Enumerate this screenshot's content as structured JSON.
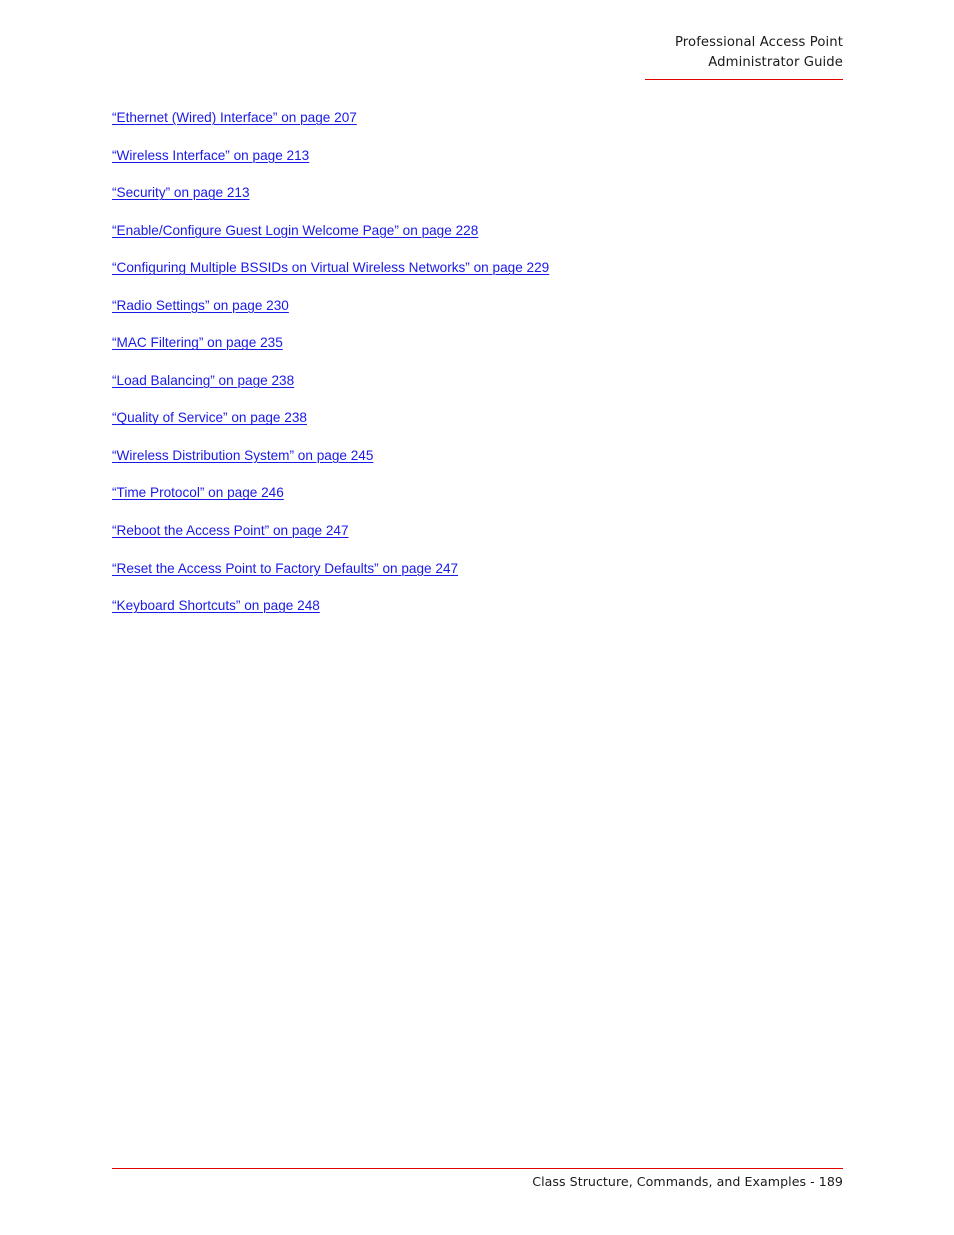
{
  "header": {
    "title_line1": "Professional Access Point",
    "title_line2": "Administrator Guide",
    "rule_color": "#e00000"
  },
  "body": {
    "link_color": "#1a1ae6",
    "links": [
      {
        "text": "“Ethernet (Wired) Interface” on page 207"
      },
      {
        "text": "“Wireless Interface” on page 213"
      },
      {
        "text": "“Security” on page 213"
      },
      {
        "text": "“Enable/Configure Guest Login Welcome Page” on page 228"
      },
      {
        "text": "“Configuring Multiple BSSIDs on Virtual Wireless Networks” on page 229"
      },
      {
        "text": "“Radio Settings” on page 230"
      },
      {
        "text": "“MAC Filtering” on page 235"
      },
      {
        "text": "“Load Balancing” on page 238"
      },
      {
        "text": "“Quality of Service” on page 238"
      },
      {
        "text": "“Wireless Distribution System” on page 245"
      },
      {
        "text": "“Time Protocol” on page 246"
      },
      {
        "text": "“Reboot the Access Point” on page 247"
      },
      {
        "text": "“Reset the Access Point to Factory Defaults” on page 247"
      },
      {
        "text": "“Keyboard Shortcuts” on page 248"
      }
    ]
  },
  "footer": {
    "text": "Class Structure, Commands, and Examples - 189",
    "rule_color": "#e00000"
  }
}
